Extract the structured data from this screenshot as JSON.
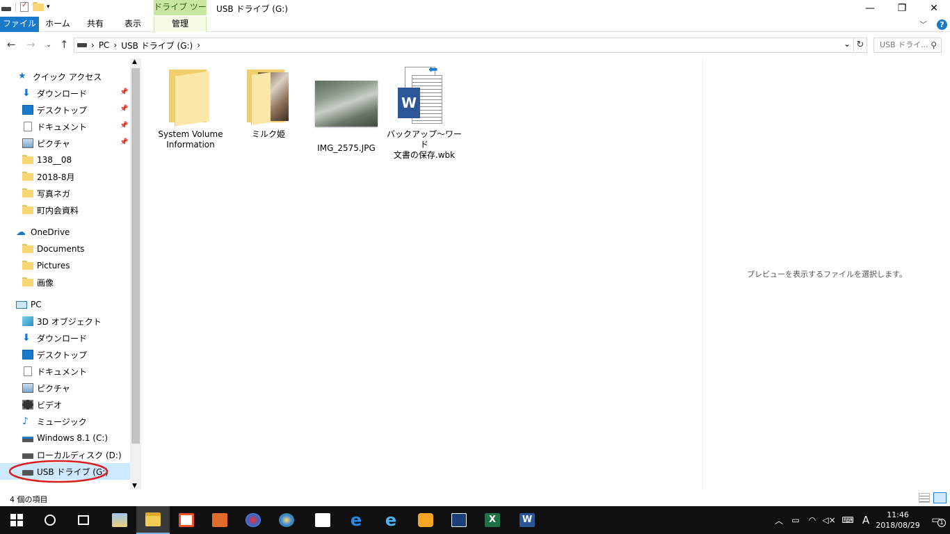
{
  "window": {
    "title": "USB ドライブ (G:)",
    "contextual_tab_group": "ドライブ ツール",
    "minimize": "—",
    "maximize": "❐",
    "close": "✕"
  },
  "ribbon": {
    "tabs": [
      "ファイル",
      "ホーム",
      "共有",
      "表示",
      "管理"
    ],
    "collapse_icon": "﹀",
    "help_icon": "?"
  },
  "address": {
    "segments": [
      "PC",
      "USB ドライブ (G:)"
    ],
    "separator": "›",
    "search_placeholder": "USB ドライ...",
    "dropdown_icon": "⌄",
    "refresh_icon": "↻"
  },
  "nav": {
    "quick_access": "クイック アクセス",
    "quick_items": [
      {
        "label": "ダウンロード",
        "icon": "download-icon",
        "pinned": true
      },
      {
        "label": "デスクトップ",
        "icon": "desktop-icon",
        "pinned": true
      },
      {
        "label": "ドキュメント",
        "icon": "documents-icon",
        "pinned": true
      },
      {
        "label": "ピクチャ",
        "icon": "pictures-icon",
        "pinned": true
      },
      {
        "label": "138__08",
        "icon": "folder-icon",
        "pinned": false
      },
      {
        "label": "2018-8月",
        "icon": "folder-icon",
        "pinned": false
      },
      {
        "label": "写真ネガ",
        "icon": "folder-icon",
        "pinned": false
      },
      {
        "label": "町内会資料",
        "icon": "folder-icon",
        "pinned": false
      }
    ],
    "onedrive": "OneDrive",
    "onedrive_items": [
      "Documents",
      "Pictures",
      "画像"
    ],
    "pc": "PC",
    "pc_items": [
      {
        "label": "3D オブジェクト",
        "icon": "3d-objects-icon"
      },
      {
        "label": "ダウンロード",
        "icon": "download-icon"
      },
      {
        "label": "デスクトップ",
        "icon": "desktop-icon"
      },
      {
        "label": "ドキュメント",
        "icon": "documents-icon"
      },
      {
        "label": "ピクチャ",
        "icon": "pictures-icon"
      },
      {
        "label": "ビデオ",
        "icon": "videos-icon"
      },
      {
        "label": "ミュージック",
        "icon": "music-icon"
      },
      {
        "label": "Windows 8.1 (C:)",
        "icon": "windows-drive-icon"
      },
      {
        "label": "ローカルディスク (D:)",
        "icon": "drive-icon"
      },
      {
        "label": "USB ドライブ (G:)",
        "icon": "usb-drive-icon"
      }
    ]
  },
  "files": [
    {
      "line1": "System Volume",
      "line2": "Information",
      "kind": "folder"
    },
    {
      "line1": "ミルク姫",
      "line2": "",
      "kind": "photo-folder"
    },
    {
      "line1": "IMG_2575.JPG",
      "line2": "",
      "kind": "photo"
    },
    {
      "line1": "バックアップ～ワード",
      "line2": "文書の保存.wbk",
      "kind": "word-backup"
    }
  ],
  "preview": {
    "message": "プレビューを表示するファイルを選択します。"
  },
  "status": {
    "item_count": "4 個の項目"
  },
  "tray": {
    "time": "11:46",
    "date": "2018/08/29",
    "ime": "A",
    "notification_count": "1"
  },
  "colors": {
    "accent": "#1979ca",
    "drive_tools": "#c9e7a0",
    "taskbar": "#101010",
    "selection": "#cde8ff"
  }
}
